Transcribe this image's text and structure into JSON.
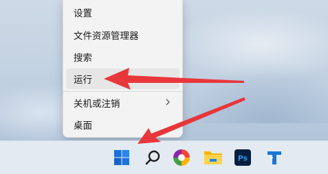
{
  "context_menu": {
    "items": [
      {
        "label": "设置"
      },
      {
        "label": "文件资源管理器"
      },
      {
        "label": "搜索"
      },
      {
        "label": "运行"
      },
      {
        "label": "关机或注销",
        "has_submenu": true
      },
      {
        "label": "桌面"
      }
    ]
  },
  "taskbar": {
    "icons": [
      {
        "name": "windows-start"
      },
      {
        "name": "search"
      },
      {
        "name": "colorful-app"
      },
      {
        "name": "file-explorer"
      },
      {
        "name": "photoshop",
        "text": "Ps"
      },
      {
        "name": "blue-app"
      }
    ]
  },
  "colors": {
    "arrow": "#e8373a",
    "windows_blue": "#1e6fd6"
  }
}
